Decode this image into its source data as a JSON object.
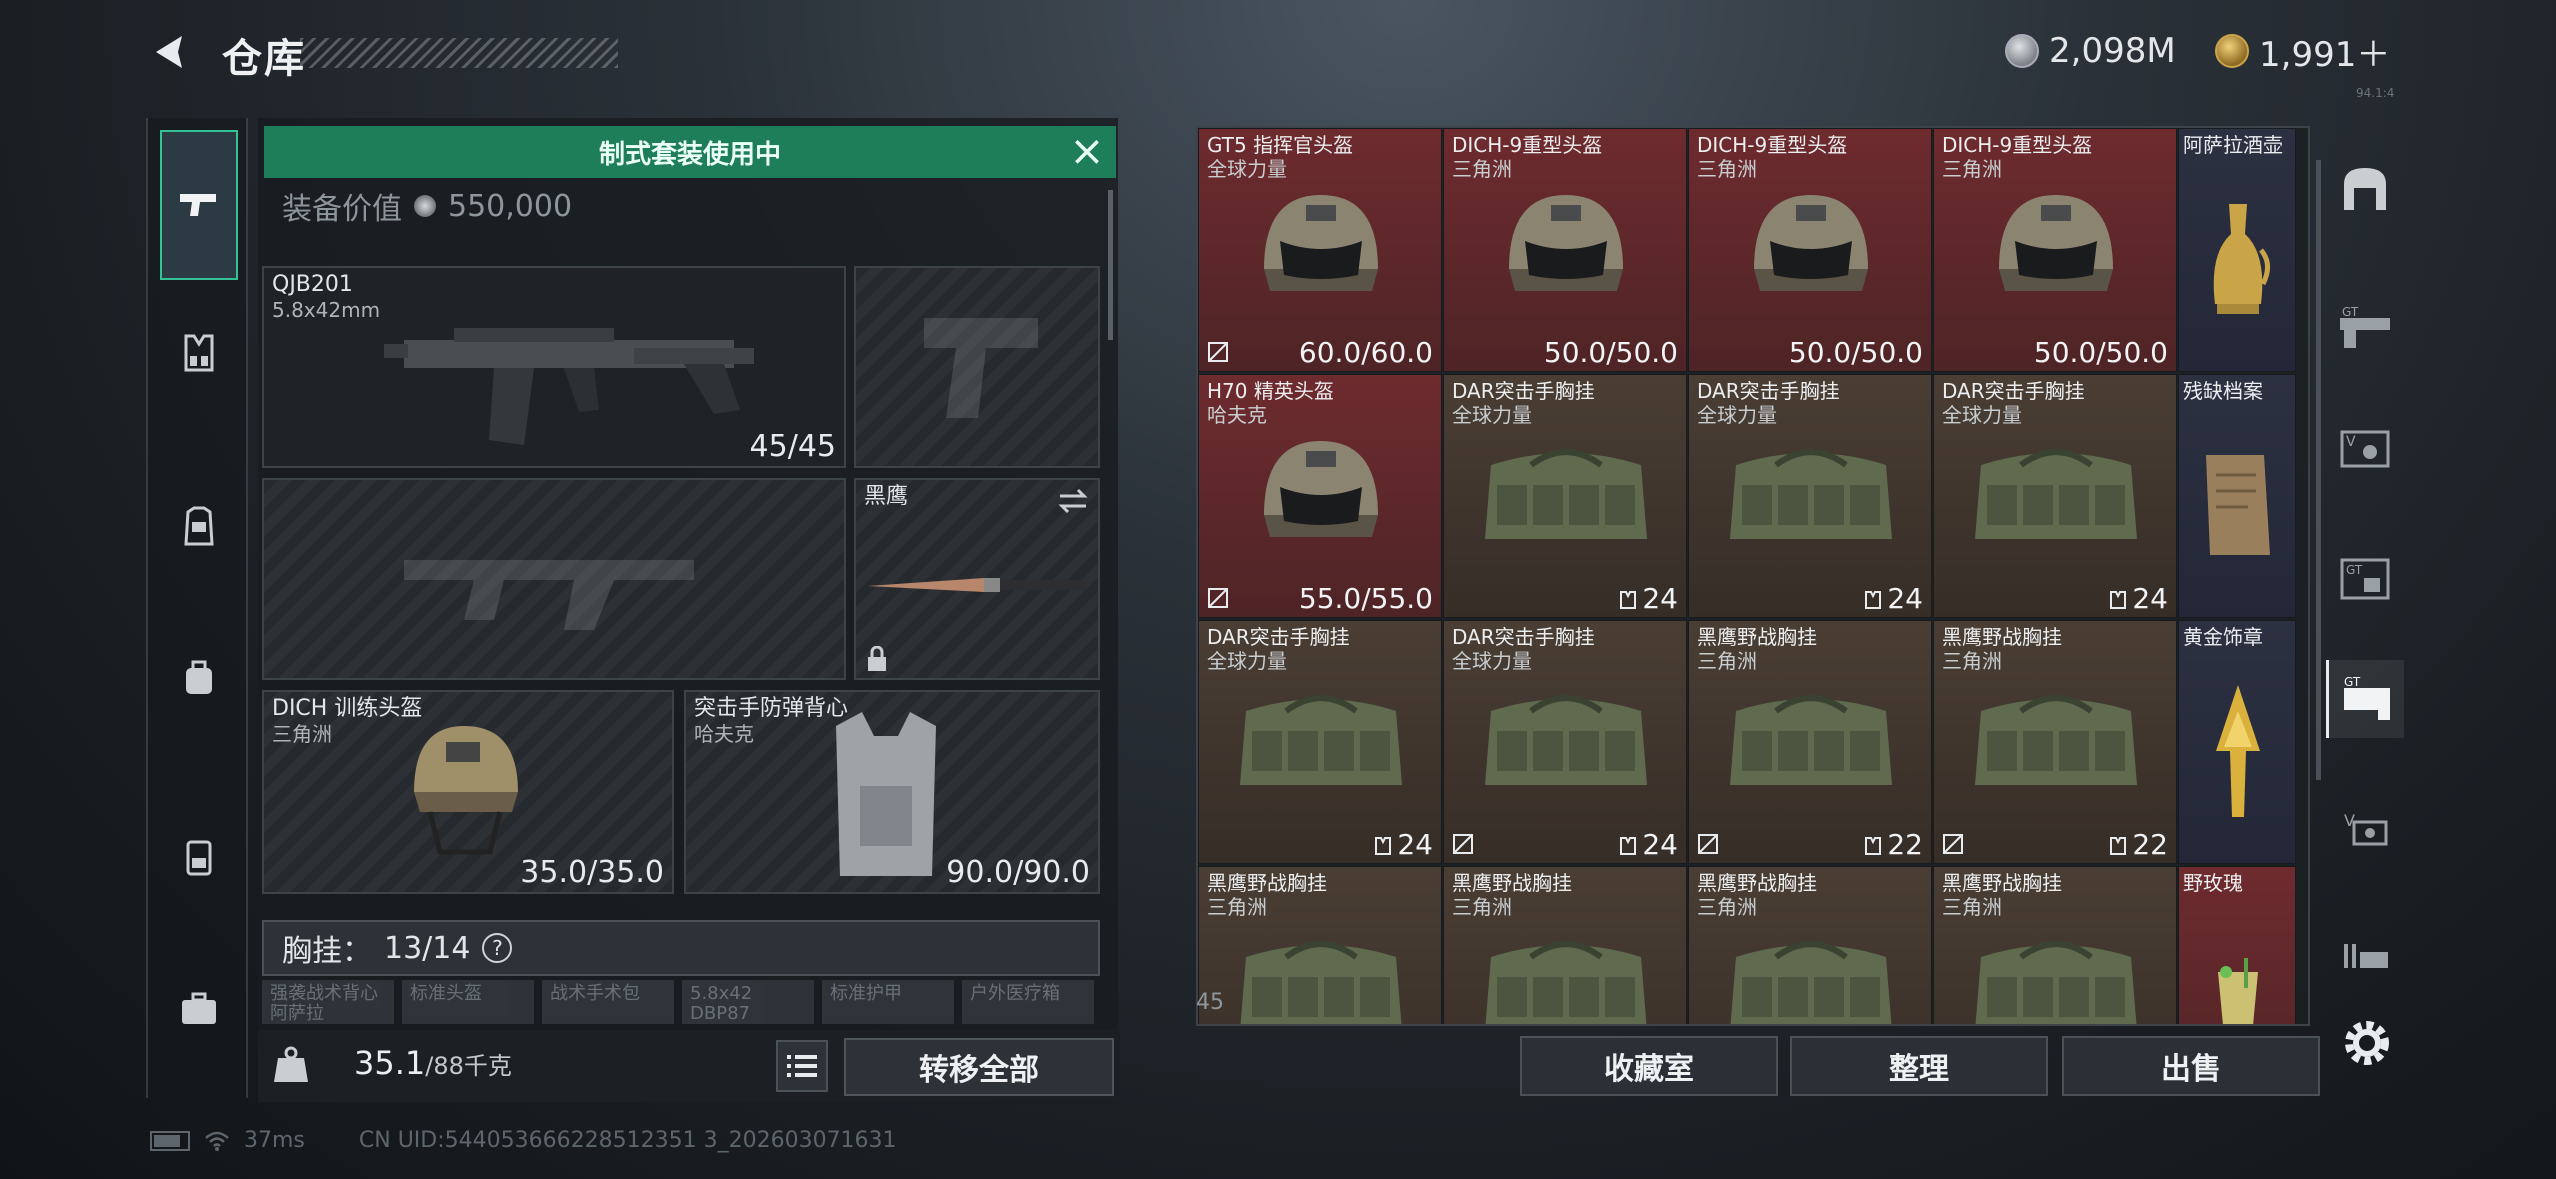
{
  "header": {
    "title": "仓库",
    "currency1": "2,098M",
    "currency2": "1,991＋",
    "tiny": "94.1:4"
  },
  "loadout": {
    "banner": "制式套装使用中",
    "value_label": "装备价值",
    "value": "550,000",
    "primary": {
      "name": "QJB201",
      "ammo_type": "5.8x42mm",
      "ammo": "45/45"
    },
    "knife": {
      "name": "黑鹰"
    },
    "helmet": {
      "name": "DICH 训练头盔",
      "source": "三角洲",
      "durability": "35.0/35.0"
    },
    "armor": {
      "name": "突击手防弹背心",
      "source": "哈夫克",
      "durability": "90.0/90.0"
    },
    "chest": {
      "label": "胸挂：",
      "count": "13/14",
      "help": "?"
    },
    "chips": [
      {
        "l1": "强袭战术背心",
        "l2": "阿萨拉"
      },
      {
        "l1": "标准头盔",
        "l2": ""
      },
      {
        "l1": "战术手术包",
        "l2": ""
      },
      {
        "l1": "5.8x42",
        "l2": "DBP87"
      },
      {
        "l1": "标准护甲",
        "l2": ""
      },
      {
        "l1": "户外医疗箱",
        "l2": ""
      }
    ],
    "weight": "35.1",
    "weight_max": "/88千克",
    "move_all": "转移全部"
  },
  "status": {
    "ping": "37ms",
    "uid": "CN UID:544053666228512351 3_202603071631"
  },
  "stash": {
    "rows": [
      [
        {
          "name": "GT5 指挥官头盔",
          "source": "全球力量",
          "durability": "60.0/60.0",
          "color": "red",
          "icon": "helmet-icon",
          "no_trade": true
        },
        {
          "name": "DICH-9重型头盔",
          "source": "三角洲",
          "durability": "50.0/50.0",
          "color": "red",
          "icon": "helmet-icon"
        },
        {
          "name": "DICH-9重型头盔",
          "source": "三角洲",
          "durability": "50.0/50.0",
          "color": "red",
          "icon": "helmet-icon"
        },
        {
          "name": "DICH-9重型头盔",
          "source": "三角洲",
          "durability": "50.0/50.0",
          "color": "red",
          "icon": "helmet-icon"
        }
      ],
      [
        {
          "name": "H70 精英头盔",
          "source": "哈夫克",
          "durability": "55.0/55.0",
          "color": "red",
          "icon": "helmet-icon",
          "no_trade": true
        },
        {
          "name": "DAR突击手胸挂",
          "source": "全球力量",
          "durability": "24",
          "color": "brown",
          "icon": "vest-icon"
        },
        {
          "name": "DAR突击手胸挂",
          "source": "全球力量",
          "durability": "24",
          "color": "brown",
          "icon": "vest-icon"
        },
        {
          "name": "DAR突击手胸挂",
          "source": "全球力量",
          "durability": "24",
          "color": "brown",
          "icon": "vest-icon"
        }
      ],
      [
        {
          "name": "DAR突击手胸挂",
          "source": "全球力量",
          "durability": "24",
          "color": "brown",
          "icon": "vest-icon"
        },
        {
          "name": "DAR突击手胸挂",
          "source": "全球力量",
          "durability": "24",
          "color": "brown",
          "icon": "vest-icon",
          "no_trade": true
        },
        {
          "name": "黑鹰野战胸挂",
          "source": "三角洲",
          "durability": "22",
          "color": "brown",
          "icon": "vest-icon",
          "no_trade": true
        },
        {
          "name": "黑鹰野战胸挂",
          "source": "三角洲",
          "durability": "22",
          "color": "brown",
          "icon": "vest-icon",
          "no_trade": true
        }
      ],
      [
        {
          "name": "黑鹰野战胸挂",
          "source": "三角洲",
          "durability": "",
          "color": "brown",
          "icon": "vest-icon"
        },
        {
          "name": "黑鹰野战胸挂",
          "source": "三角洲",
          "durability": "",
          "color": "brown",
          "icon": "vest-icon"
        },
        {
          "name": "黑鹰野战胸挂",
          "source": "三角洲",
          "durability": "",
          "color": "brown",
          "icon": "vest-icon"
        },
        {
          "name": "黑鹰野战胸挂",
          "source": "三角洲",
          "durability": "",
          "color": "brown",
          "icon": "vest-icon"
        }
      ]
    ],
    "side": [
      {
        "name": "阿萨拉酒壶",
        "color": "blue",
        "icon": "jug-icon"
      },
      {
        "name": "残缺档案",
        "color": "blue",
        "icon": "document-icon"
      },
      {
        "name": "黄金饰章",
        "color": "blue",
        "icon": "gold-emblem-icon"
      },
      {
        "name": "野玫瑰",
        "color": "red",
        "icon": "drink-icon"
      }
    ],
    "count": "45"
  },
  "actions": {
    "collection": "收藏室",
    "sort": "整理",
    "sell": "出售"
  },
  "colors": {
    "accent": "#1f7e5a",
    "red_cell": "#6e2b2e",
    "brown_cell": "#4a3e34",
    "blue_cell": "#2c3142"
  }
}
